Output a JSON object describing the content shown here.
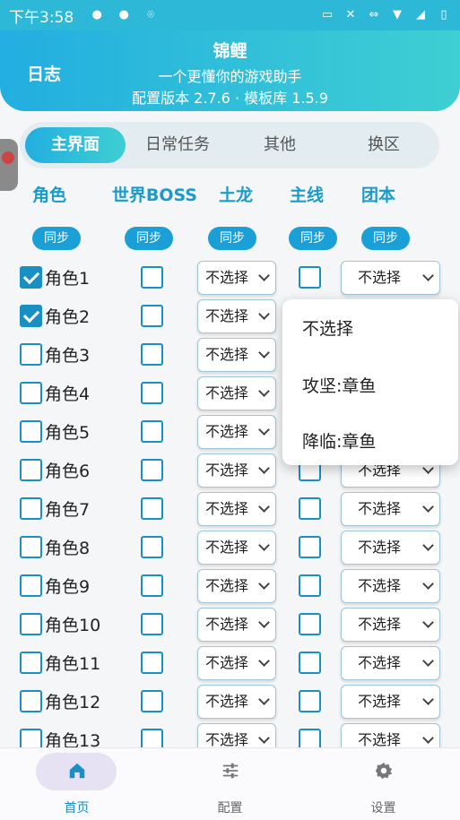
{
  "status_bar": {
    "time": "下午3:58"
  },
  "header": {
    "log_label": "日志",
    "title": "锦鲤",
    "subtitle": "一个更懂你的游戏助手",
    "version": "配置版本 2.7.6 · 模板库 1.5.9"
  },
  "tabs": [
    "主界面",
    "日常任务",
    "其他",
    "换区"
  ],
  "active_tab": "主界面",
  "columns": {
    "role": "角色",
    "world_boss": "世界BOSS",
    "earth_dragon": "土龙",
    "main_line": "主线",
    "raid": "团本"
  },
  "sync_label": "同步",
  "select_default": "不选择",
  "rows": [
    {
      "label": "角色1",
      "checked": true
    },
    {
      "label": "角色2",
      "checked": true
    },
    {
      "label": "角色3",
      "checked": false
    },
    {
      "label": "角色4",
      "checked": false
    },
    {
      "label": "角色5",
      "checked": false
    },
    {
      "label": "角色6",
      "checked": false
    },
    {
      "label": "角色7",
      "checked": false
    },
    {
      "label": "角色8",
      "checked": false
    },
    {
      "label": "角色9",
      "checked": false
    },
    {
      "label": "角色10",
      "checked": false
    },
    {
      "label": "角色11",
      "checked": false
    },
    {
      "label": "角色12",
      "checked": false
    },
    {
      "label": "角色13",
      "checked": false
    }
  ],
  "dropdown_options": [
    "不选择",
    "攻坚:章鱼",
    "降临:章鱼"
  ],
  "bottom_nav": [
    {
      "label": "首页",
      "icon": "home-icon",
      "active": true
    },
    {
      "label": "配置",
      "icon": "sliders-icon",
      "active": false
    },
    {
      "label": "设置",
      "icon": "gear-icon",
      "active": false
    }
  ],
  "colors": {
    "accent": "#1a9fd6",
    "header_start": "#22aee0",
    "header_end": "#3ecfd3",
    "nav_active": "#1a8fc4"
  }
}
